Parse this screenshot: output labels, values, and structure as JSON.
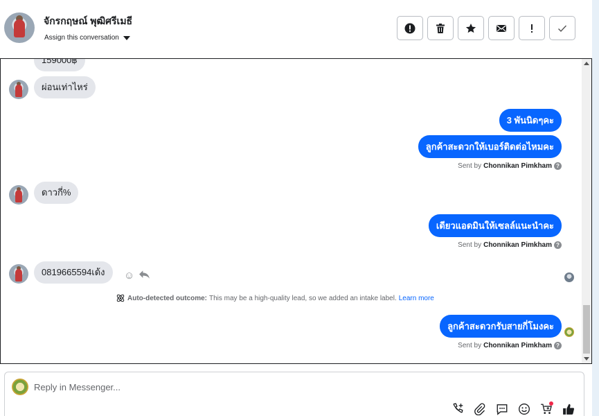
{
  "header": {
    "contact_name": "จักรกฤษณ์ พุฒิศรีเมธี",
    "assign_label": "Assign this conversation",
    "toolbar": [
      {
        "name": "report-button",
        "icon": "exclamation-circle-icon",
        "label": "Report"
      },
      {
        "name": "delete-button",
        "icon": "trash-icon",
        "label": "Delete"
      },
      {
        "name": "star-button",
        "icon": "star-icon",
        "label": "Star"
      },
      {
        "name": "mark-unread-button",
        "icon": "envelope-icon",
        "label": "Mark unread"
      },
      {
        "name": "spam-button",
        "icon": "exclamation-icon",
        "label": "Spam"
      },
      {
        "name": "done-button",
        "icon": "check-icon",
        "label": "Done"
      }
    ]
  },
  "messages": {
    "m1": "159000฿",
    "m2": "ผ่อนเท่าไหร่",
    "m3": "3 พันนิดๆคะ",
    "m4": "ลูกค้าสะดวกให้เบอร์ติดต่อไหมคะ",
    "m5": "ดาวกี่%",
    "m6": "เดียวแอดมินให้เซลล์แนะนำคะ",
    "m7": "0819665594เด้ง",
    "m8": "ลูกค้าสะดวกรับสายกี่โมงคะ"
  },
  "sent_by": {
    "prefix": "Sent by",
    "agent": "Chonnikan Pimkham"
  },
  "outcome": {
    "label": "Auto-detected outcome:",
    "text": "This may be a high-quality lead, so we added an intake label.",
    "link": "Learn more"
  },
  "composer": {
    "placeholder": "Reply in Messenger..."
  },
  "colors": {
    "outgoing_bubble": "#0866ff",
    "incoming_bubble": "#e4e6eb",
    "link": "#0866ff"
  }
}
